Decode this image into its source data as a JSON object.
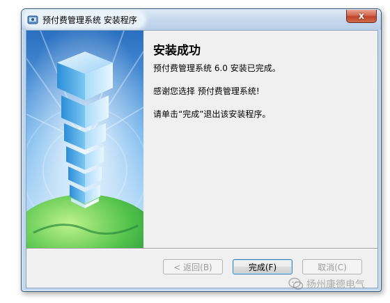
{
  "window": {
    "title": "预付费管理系统 安装程序",
    "close_label": "x"
  },
  "content": {
    "heading": "安装成功",
    "line1": "预付费管理系统 6.0 安装已完成。",
    "line2": "感谢您选择 预付费管理系统!",
    "line3": "请单击“完成”退出该安装程序。"
  },
  "buttons": {
    "back": "< 返回(B)",
    "finish": "完成(F)",
    "cancel": "取消(C)"
  },
  "watermark": {
    "text": "扬州康德电气"
  }
}
